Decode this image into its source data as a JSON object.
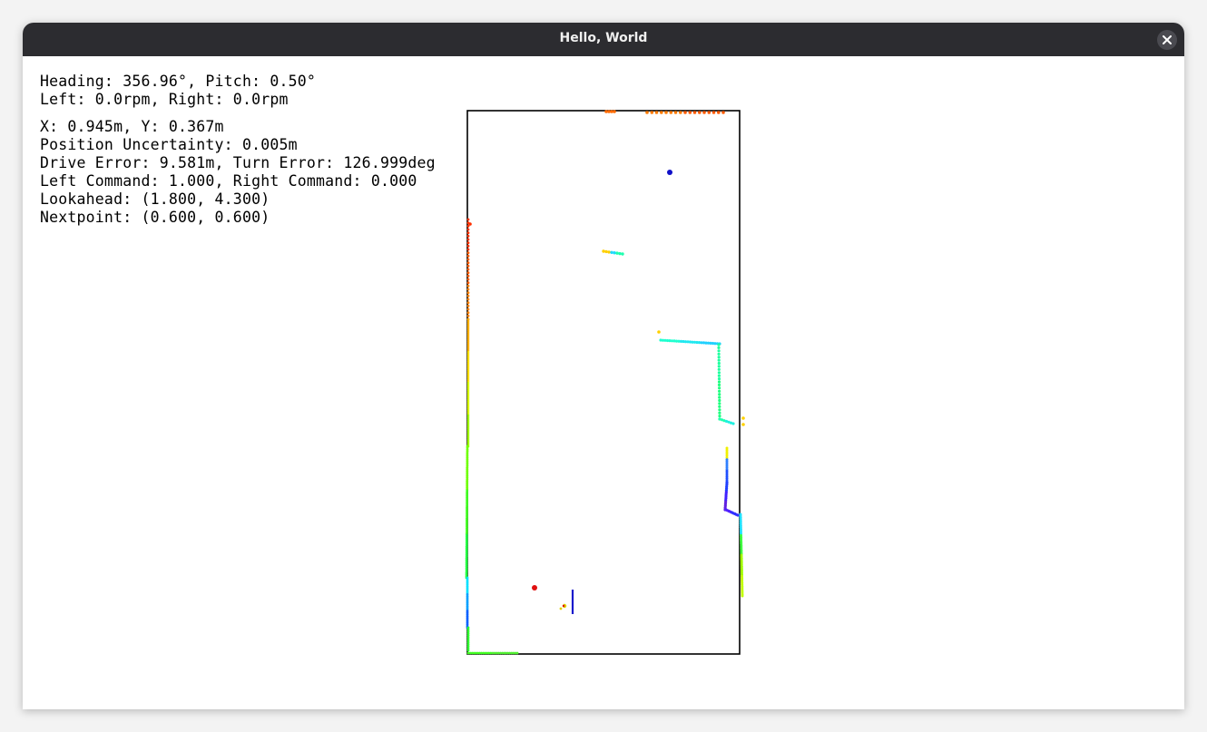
{
  "window": {
    "title": "Hello, World",
    "close_icon": "close-icon"
  },
  "telemetry": {
    "heading_line": "Heading: 356.96°, Pitch: 0.50°",
    "rpm_line": "Left: 0.0rpm, Right: 0.0rpm",
    "position_line": "X: 0.945m, Y: 0.367m",
    "uncertainty_line": "Position Uncertainty: 0.005m",
    "error_line": "Drive Error: 9.581m, Turn Error: 126.999deg",
    "command_line": "Left Command: 1.000, Right Command: 0.000",
    "lookahead_line": "Lookahead: (1.800, 4.300)",
    "nextpoint_line": "Nextpoint: (0.600, 0.600)"
  },
  "colors": {
    "titlebar": "#2c2c30",
    "field_border": "#000000",
    "robot_heading": "#1a1acc",
    "target_marker": "#e01010",
    "lookahead_marker": "#1010c8"
  }
}
